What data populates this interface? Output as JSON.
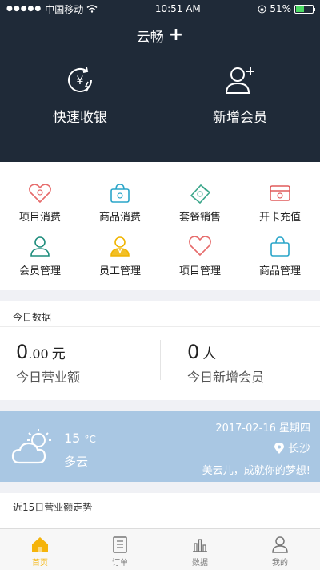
{
  "statusbar": {
    "carrier": "中国移动",
    "time": "10:51 AM",
    "battery": "51%"
  },
  "nav": {
    "title": "云畅",
    "plus": "+"
  },
  "quick": [
    {
      "label": "快速收银"
    },
    {
      "label": "新增会员"
    }
  ],
  "grid": [
    {
      "label": "项目消费",
      "icon": "heart-tag-icon",
      "color": "#e66a6a"
    },
    {
      "label": "商品消费",
      "icon": "shopping-bag-icon",
      "color": "#2aa5c9"
    },
    {
      "label": "套餐销售",
      "icon": "ticket-icon",
      "color": "#3aa68a"
    },
    {
      "label": "开卡充值",
      "icon": "card-icon",
      "color": "#e05b5b"
    },
    {
      "label": "会员管理",
      "icon": "member-icon",
      "color": "#1f8d7d"
    },
    {
      "label": "员工管理",
      "icon": "staff-icon",
      "color": "#f0b400"
    },
    {
      "label": "项目管理",
      "icon": "heart-icon",
      "color": "#e66a6a"
    },
    {
      "label": "商品管理",
      "icon": "basket-icon",
      "color": "#2aa5c9"
    }
  ],
  "today": {
    "title": "今日数据",
    "revenue_int": "0",
    "revenue_dec": ".00",
    "revenue_unit": "元",
    "revenue_caption": "今日营业额",
    "members": "0",
    "members_unit": "人",
    "members_caption": "今日新增会员"
  },
  "weather": {
    "temp": "15",
    "temp_unit": "°C",
    "condition": "多云",
    "date": "2017-02-16 星期四",
    "city": "长沙",
    "slogan": "美云儿，成就你的梦想!"
  },
  "trend": {
    "title": "近15日营业额走势"
  },
  "tabs": [
    {
      "label": "首页",
      "active": true
    },
    {
      "label": "订单"
    },
    {
      "label": "数据"
    },
    {
      "label": "我的"
    }
  ]
}
